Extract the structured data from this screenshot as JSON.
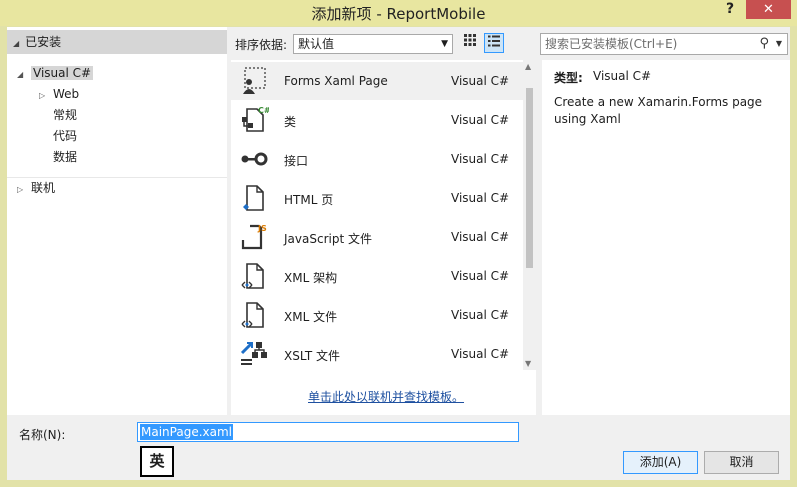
{
  "window": {
    "title": "添加新项 - ReportMobile",
    "help_label": "?",
    "close_label": "✕"
  },
  "left": {
    "installed_label": "已安装",
    "tree": {
      "visual_csharp": "Visual C#",
      "web": "Web",
      "general": "常规",
      "code": "代码",
      "data": "数据",
      "online": "联机"
    }
  },
  "toolbar": {
    "sort_label": "排序依据:",
    "sort_value": "默认值",
    "search_placeholder": "搜索已安装模板(Ctrl+E)"
  },
  "templates": [
    {
      "name": "Forms Xaml Page",
      "lang": "Visual C#",
      "icon": "forms-xaml-page-icon"
    },
    {
      "name": "类",
      "lang": "Visual C#",
      "icon": "class-icon"
    },
    {
      "name": "接口",
      "lang": "Visual C#",
      "icon": "interface-icon"
    },
    {
      "name": "HTML 页",
      "lang": "Visual C#",
      "icon": "html-file-icon"
    },
    {
      "name": "JavaScript 文件",
      "lang": "Visual C#",
      "icon": "javascript-file-icon"
    },
    {
      "name": "XML 架构",
      "lang": "Visual C#",
      "icon": "xml-schema-icon"
    },
    {
      "name": "XML 文件",
      "lang": "Visual C#",
      "icon": "xml-file-icon"
    },
    {
      "name": "XSLT 文件",
      "lang": "Visual C#",
      "icon": "xslt-file-icon"
    }
  ],
  "online_link": "单击此处以联机并查找模板。",
  "details": {
    "type_label": "类型:",
    "type_value": "Visual C#",
    "description": "Create a new Xamarin.Forms page using Xaml"
  },
  "bottom": {
    "name_label": "名称(N):",
    "name_value": "MainPage.xaml",
    "ime_indicator": "英",
    "add_button": "添加(A)",
    "cancel_button": "取消"
  },
  "colors": {
    "title_bar": "#e8e6a0",
    "close_button": "#c75050",
    "selection_accent": "#3399ff",
    "link": "#1e50a0"
  }
}
